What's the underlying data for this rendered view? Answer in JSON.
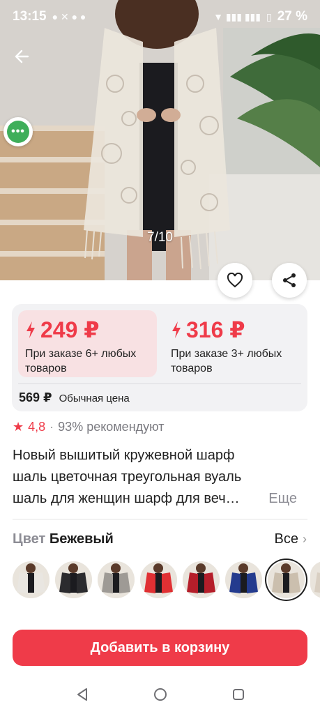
{
  "status_bar": {
    "time": "13:15",
    "battery": "27 %"
  },
  "gallery": {
    "counter": "7/10"
  },
  "prices": [
    {
      "amount": "249 ₽",
      "condition": "При заказе 6+ любых товаров"
    },
    {
      "amount": "316 ₽",
      "condition": "При заказе 3+ любых товаров"
    }
  ],
  "regular_price": {
    "amount": "569 ₽",
    "label": "Обычная цена"
  },
  "rating": {
    "value": "4,8",
    "separator": "·",
    "recommend": "93% рекомендуют"
  },
  "product_title": {
    "lines": [
      "Новый вышитый кружевной шарф",
      "шаль цветочная треугольная вуаль",
      "шаль для женщин шарф для веч…"
    ],
    "more_label": "Еще"
  },
  "color": {
    "label": "Цвет",
    "selected": "Бежевый",
    "all_label": "Все"
  },
  "swatches": [
    {
      "name": "white",
      "color": "#e9e6e1"
    },
    {
      "name": "black",
      "color": "#2b2b2e"
    },
    {
      "name": "grey",
      "color": "#9e9a95"
    },
    {
      "name": "red",
      "color": "#e03033"
    },
    {
      "name": "wine",
      "color": "#b51e2a"
    },
    {
      "name": "navy",
      "color": "#243b8e"
    },
    {
      "name": "ivory",
      "color": "#f1efe9"
    },
    {
      "name": "beige",
      "color": "#cbbfae"
    },
    {
      "name": "cream",
      "color": "#d9cfc2"
    }
  ],
  "add_to_cart": "Добавить в корзину",
  "colors": {
    "accent": "#ef3b49",
    "badge_green": "#3fae5a"
  }
}
